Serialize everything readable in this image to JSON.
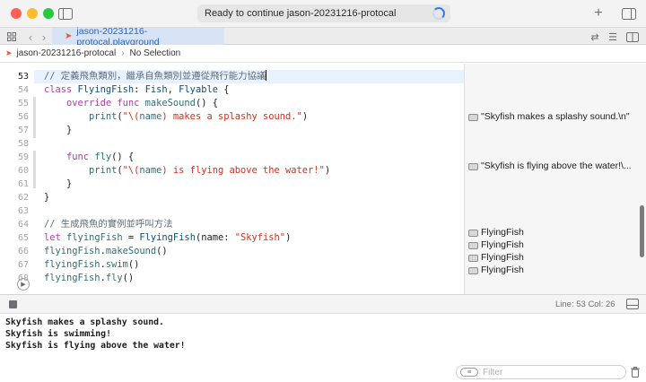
{
  "window": {
    "status": "Ready to continue jason-20231216-protocal"
  },
  "tab": {
    "label": "jason-20231216-protocal.playground"
  },
  "jumpbar": {
    "file": "jason-20231216-protocal",
    "selection": "No Selection"
  },
  "editor": {
    "line_numbers": [
      "53",
      "54",
      "55",
      "56",
      "57",
      "58",
      "59",
      "60",
      "61",
      "62",
      "63",
      "64",
      "65",
      "66",
      "67",
      "68"
    ],
    "current_line": "53"
  },
  "code": {
    "l53_comment": "// 定義飛魚類別，繼承自魚類別並遵從飛行能力協議",
    "l54_class": "class",
    "l54_name": "FlyingFish",
    "l54_colon": ": ",
    "l54_super": "Fish",
    "l54_comma": ", ",
    "l54_proto": "Flyable",
    "l54_brace": " {",
    "l55_override": "override",
    "l55_func": "func",
    "l55_name": "makeSound",
    "l55_rest": "() {",
    "l56_print": "print",
    "l56_paren": "(",
    "l56_str1": "\"\\(",
    "l56_var": "name",
    "l56_str2": ") makes a splashy sound.\"",
    "l56_close": ")",
    "l57_brace": "}",
    "l59_func": "func",
    "l59_name": "fly",
    "l59_rest": "() {",
    "l60_print": "print",
    "l60_paren": "(",
    "l60_str1": "\"\\(",
    "l60_var": "name",
    "l60_str2": ") is flying above the water!\"",
    "l60_close": ")",
    "l61_brace": "}",
    "l62_brace": "}",
    "l64_comment": "// 生成飛魚的實例並呼叫方法",
    "l65_let": "let",
    "l65_var": "flyingFish",
    "l65_eq": " = ",
    "l65_type": "FlyingFish",
    "l65_arg": "(name: ",
    "l65_str": "\"Skyfish\"",
    "l65_close": ")",
    "l66_var": "flyingFish",
    "l66_dot": ".",
    "l66_call": "makeSound",
    "l66_paren": "()",
    "l67_var": "flyingFish",
    "l67_dot": ".",
    "l67_call": "swim",
    "l67_paren": "()",
    "l68_var": "flyingFish",
    "l68_dot": ".",
    "l68_call": "fly",
    "l68_paren": "()"
  },
  "results": {
    "r56": "\"Skyfish makes a splashy sound.\\n\"",
    "r60": "\"Skyfish is flying above the water!\\...",
    "r65": "FlyingFish",
    "r66": "FlyingFish",
    "r67": "FlyingFish",
    "r68": "FlyingFish"
  },
  "debug": {
    "line_col": "Line: 53  Col: 26"
  },
  "console": {
    "lines": [
      "Skyfish makes a splashy sound.",
      "Skyfish is swimming!",
      "Skyfish is flying above the water!"
    ],
    "filter_placeholder": "Filter"
  },
  "colors": {
    "keyword": "#ad3da4",
    "type": "#0b4f79",
    "function": "#326d74",
    "string": "#d12f1b",
    "comment": "#5d6c79",
    "accent": "#2f7bf5"
  },
  "icons": [
    "sidebar-toggle-icon",
    "spinner-icon",
    "add-icon",
    "inspector-toggle-icon",
    "grid-icon",
    "back-icon",
    "forward-icon",
    "swift-icon",
    "swap-icon",
    "list-icon",
    "split-icon",
    "run-icon",
    "stop-icon",
    "panel-toggle-icon",
    "filter-icon",
    "trash-icon",
    "result-eye-icon"
  ]
}
